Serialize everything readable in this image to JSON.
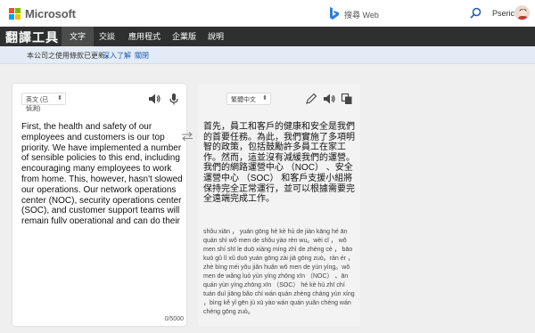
{
  "header": {
    "brand": "Microsoft",
    "search_placeholder": "搜尋 Web",
    "user": "Pseric",
    "colors": {
      "red": "#f25022",
      "green": "#7fba00",
      "blue": "#00a4ef",
      "yellow": "#ffb900"
    }
  },
  "nav": {
    "title": "翻譯工具",
    "tabs": [
      {
        "label": "文字",
        "active": true
      },
      {
        "label": "交談",
        "active": false
      },
      {
        "label": "應用程式",
        "active": false
      },
      {
        "label": "企業版",
        "active": false
      },
      {
        "label": "說明",
        "active": false
      }
    ]
  },
  "notice": {
    "message": "本公司之使用條款已更新。",
    "learn_more": "深入了解",
    "close": "關閉"
  },
  "source": {
    "language": "英文 (已偵測)",
    "text": "First, the health and safety of our employees and customers is our top priority. We have implemented a number of sensible policies to this end, including encouraging many employees to work from home. This, however, hasn't slowed our operations. Our network operations center (NOC), security operations center (SOC), and customer support teams will remain fully operational and can do their",
    "counter": "0/5000"
  },
  "target": {
    "language": "繁體中文",
    "text": "首先，員工和客戶的健康和安全是我們的首要任務。為此，我們實施了多項明智的政策，包括鼓勵許多員工在家工作。然而，這並沒有減緩我們的運營。我們的網路運營中心 （NOC） 、安全運營中心 （SOC） 和客戶支援小組將保持完全正常運行，並可以根據需要完全遠端完成工作。",
    "pinyin": "shǒu xiān ， yuán gōng hé kè hù de jiàn kāng hé ān quán shì wǒ men de shǒu yào rèn wu。wèi cǐ ， wǒ men shí shī le duō xiàng míng zhì de zhèng cè ， bāo kuò gǔ lì xǔ duō yuán gōng zài jiā gōng zuò。rán ér ，zhè bìng méi yǒu jiǎn huǎn wǒ men de yùn yíng。wǒ men de wǎng luò yùn yíng zhōng xīn （NOC） 、ān quán yùn yíng zhōng xīn （SOC） hé kè hù zhī chí tuán duì jiāng bǎo chí wán quán zhèng cháng yùn xíng ，bìng kě yǐ gēn jù xū yào wán quán yuǎn chéng wán chéng gōng zuò。"
  }
}
